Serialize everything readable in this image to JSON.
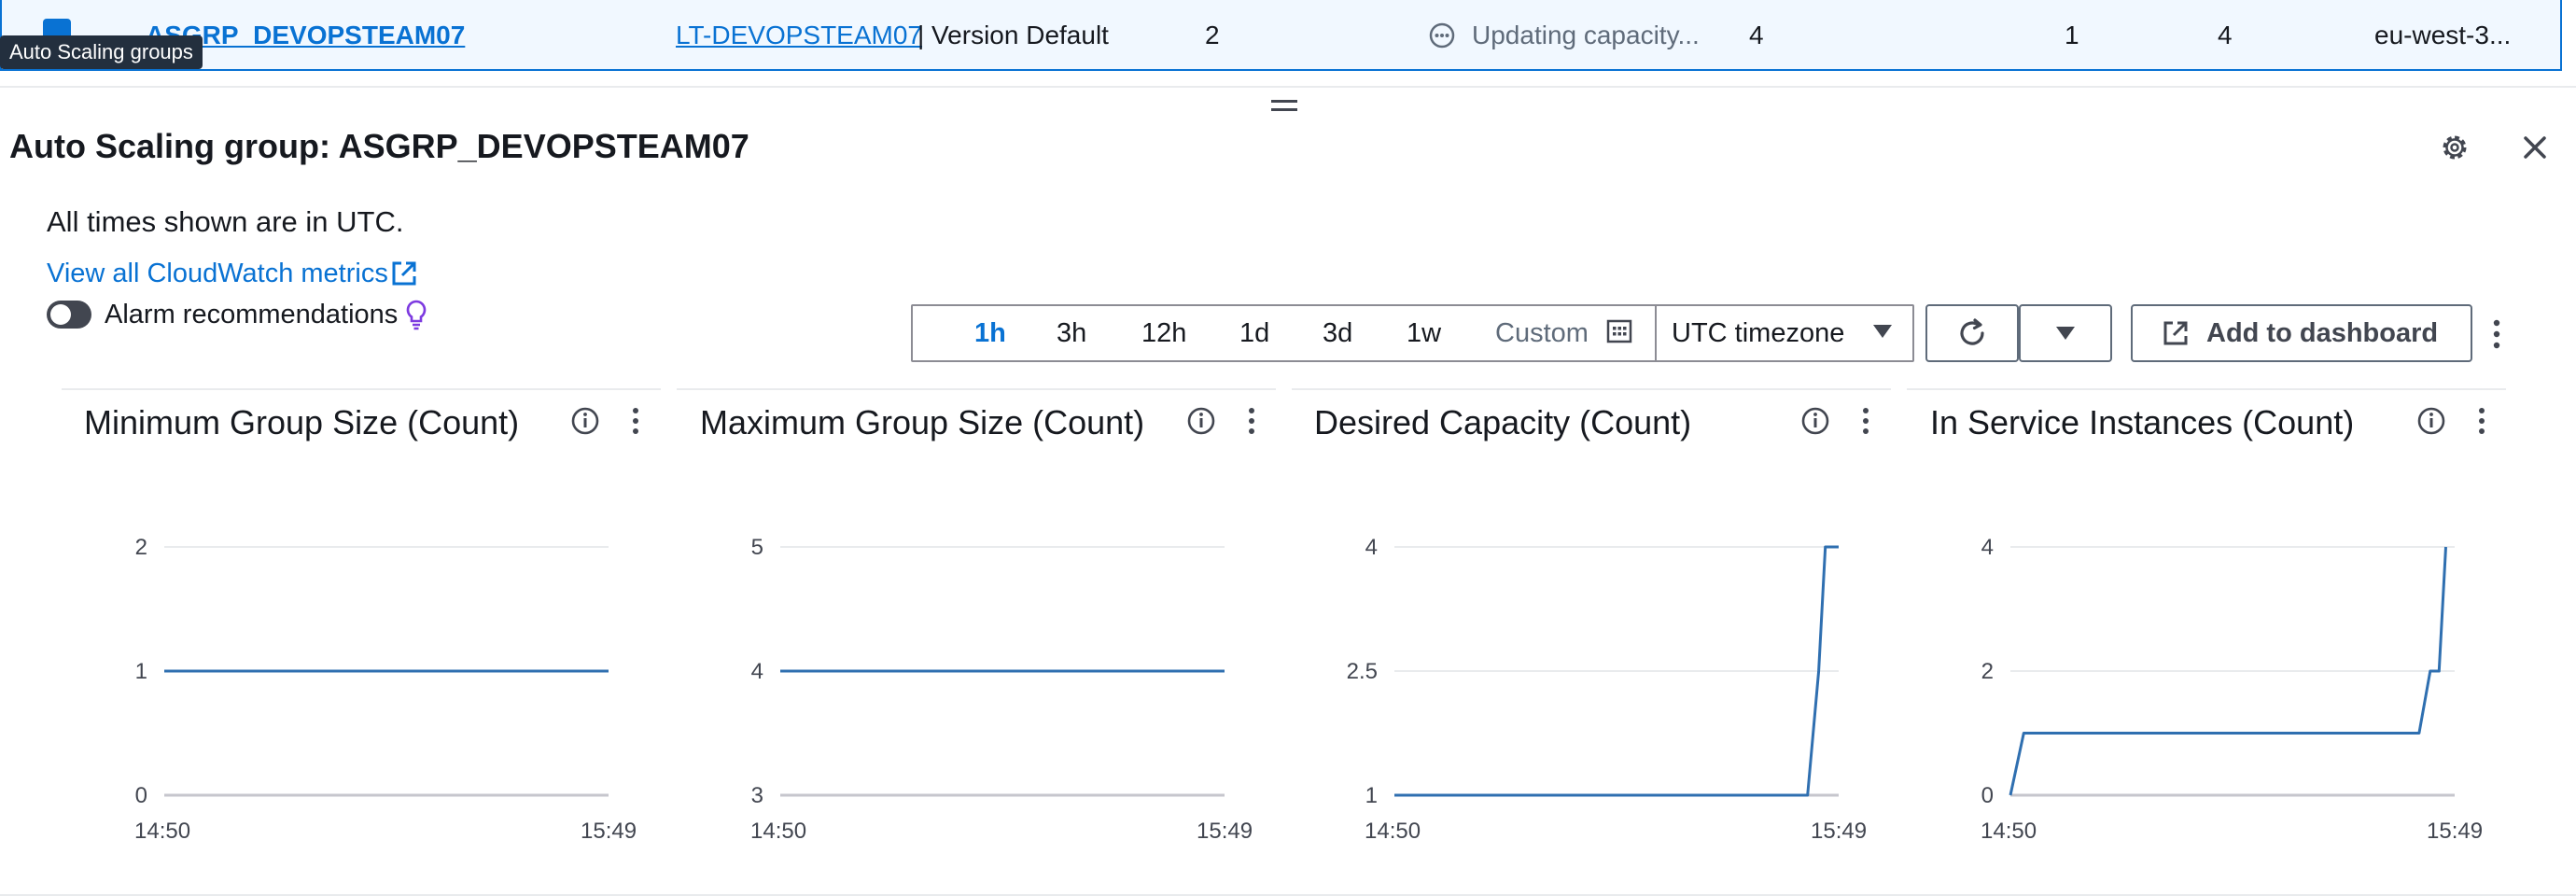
{
  "asg_row": {
    "name": "ASGRP_DEVOPSTEAM07",
    "launch_template": "LT-DEVOPSTEAM07",
    "launch_template_suffix": "| Version Default",
    "instances": "2",
    "status": "Updating capacity...",
    "desired": "4",
    "min": "1",
    "max": "4",
    "az": "eu-west-3...",
    "tooltip": "Auto Scaling groups"
  },
  "panel": {
    "title": "Auto Scaling group: ASGRP_DEVOPSTEAM07",
    "times_note": "All times shown are in UTC.",
    "cloudwatch_link": "View all CloudWatch metrics",
    "alarm_toggle_label": "Alarm recommendations"
  },
  "toolbar": {
    "ranges": [
      "1h",
      "3h",
      "12h",
      "1d",
      "3d",
      "1w"
    ],
    "custom_label": "Custom",
    "selected_range": "1h",
    "timezone": "UTC timezone",
    "add_dashboard": "Add to dashboard"
  },
  "charts": [
    {
      "title": "Minimum Group Size (Count)",
      "chart_data": {
        "type": "line",
        "x": [
          "14:50",
          "15:49"
        ],
        "yticks": [
          "0",
          "1",
          "2"
        ],
        "ylim": [
          0,
          2
        ],
        "series": [
          {
            "points": [
              [
                0,
                1
              ],
              [
                1,
                1
              ]
            ]
          }
        ]
      }
    },
    {
      "title": "Maximum Group Size (Count)",
      "chart_data": {
        "type": "line",
        "x": [
          "14:50",
          "15:49"
        ],
        "yticks": [
          "3",
          "4",
          "5"
        ],
        "ylim": [
          3,
          5
        ],
        "series": [
          {
            "points": [
              [
                0,
                4
              ],
              [
                1,
                4
              ]
            ]
          }
        ]
      }
    },
    {
      "title": "Desired Capacity (Count)",
      "chart_data": {
        "type": "line",
        "x": [
          "14:50",
          "15:49"
        ],
        "yticks": [
          "1",
          "2.5",
          "4"
        ],
        "ylim": [
          1,
          4
        ],
        "series": [
          {
            "points": [
              [
                0,
                1
              ],
              [
                0.93,
                1
              ],
              [
                0.955,
                2.5
              ],
              [
                0.97,
                4
              ],
              [
                1,
                4
              ]
            ]
          }
        ]
      }
    },
    {
      "title": "In Service Instances (Count)",
      "chart_data": {
        "type": "line",
        "x": [
          "14:50",
          "15:49"
        ],
        "yticks": [
          "0",
          "2",
          "4"
        ],
        "ylim": [
          0,
          4
        ],
        "series": [
          {
            "points": [
              [
                0,
                0
              ],
              [
                0.03,
                1
              ],
              [
                0.92,
                1
              ],
              [
                0.945,
                2
              ],
              [
                0.965,
                2
              ],
              [
                0.98,
                4
              ]
            ]
          }
        ]
      }
    }
  ],
  "colors": {
    "accent": "#0972d3",
    "line": "#2f6fb0",
    "grid": "#e9ebed",
    "axis": "#c6c6cd"
  }
}
